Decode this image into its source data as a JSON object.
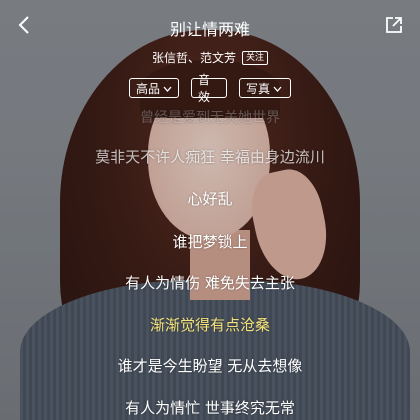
{
  "header": {
    "title": "别让情两难",
    "artists": "张信哲、范文芳",
    "follow_label": "关注"
  },
  "controls": {
    "quality_label": "高品",
    "effect_label": "音效",
    "photo_label": "写真"
  },
  "lyrics": {
    "lines": [
      "曾经是爱到无关她世界",
      "莫非天不许人痴狂 幸福由身边流川",
      "心好乱",
      "谁把梦锁上",
      "有人为情伤 难免失去主张",
      "渐渐觉得有点沧桑",
      "谁才是今生盼望 无从去想像",
      "有人为情忙 世事终究无常"
    ],
    "current_index": 5
  },
  "colors": {
    "current_line": "#f5e27a",
    "text": "#ffffff"
  },
  "icons": {
    "back": "chevron-left-icon",
    "share": "share-icon",
    "dropdown": "chevron-down-icon"
  }
}
